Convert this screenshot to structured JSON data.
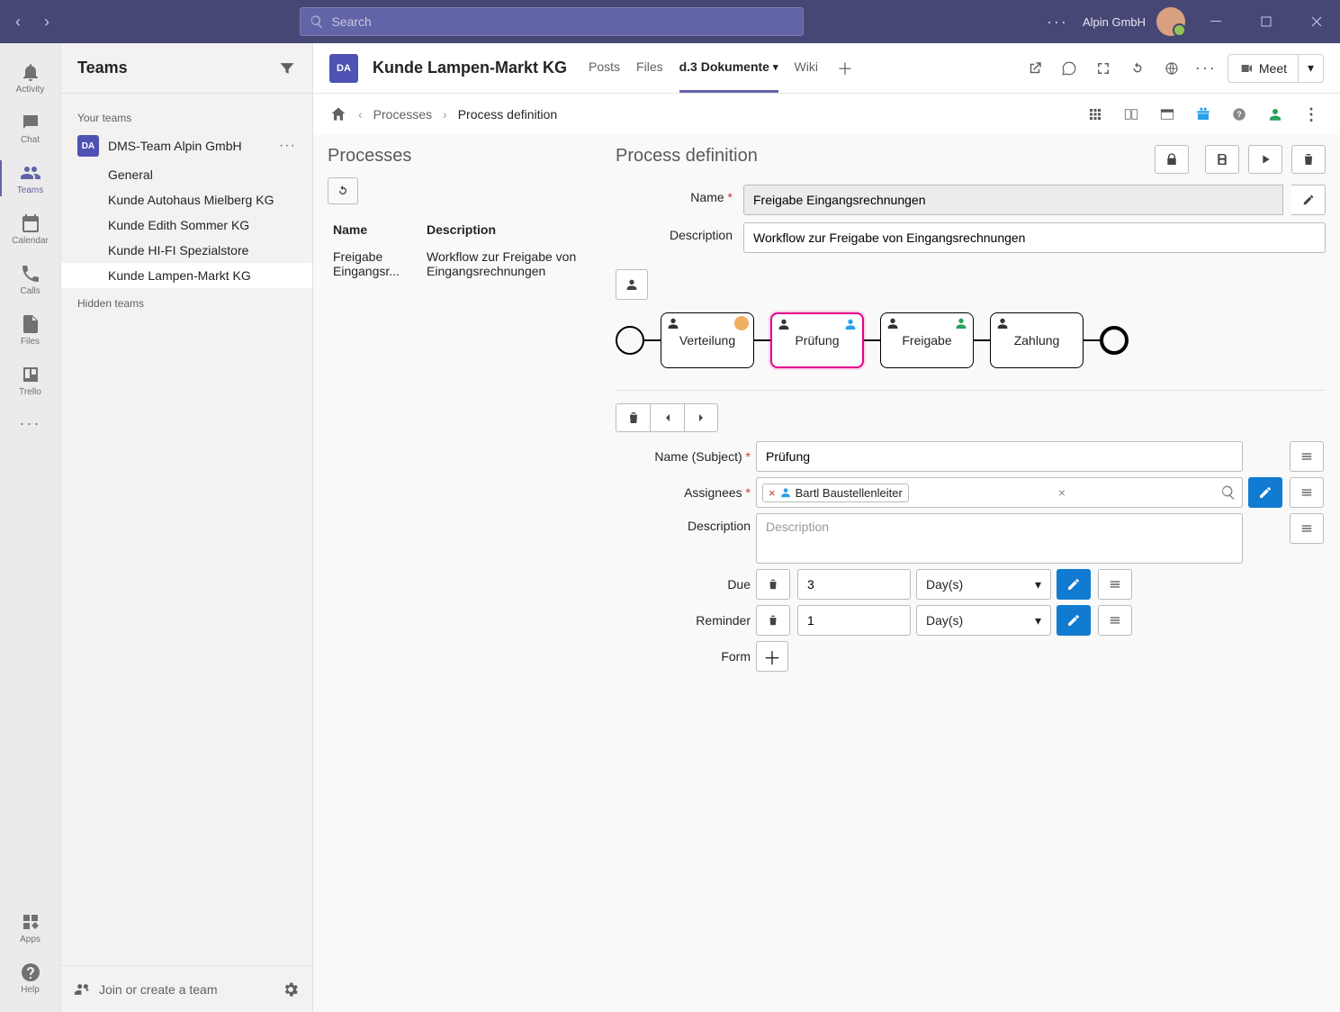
{
  "titlebar": {
    "search_placeholder": "Search",
    "org_name": "Alpin GmbH"
  },
  "rail": {
    "items": [
      {
        "key": "activity",
        "label": "Activity"
      },
      {
        "key": "chat",
        "label": "Chat"
      },
      {
        "key": "teams",
        "label": "Teams"
      },
      {
        "key": "calendar",
        "label": "Calendar"
      },
      {
        "key": "calls",
        "label": "Calls"
      },
      {
        "key": "files",
        "label": "Files"
      },
      {
        "key": "trello",
        "label": "Trello"
      }
    ],
    "apps_label": "Apps",
    "help_label": "Help"
  },
  "teams_panel": {
    "title": "Teams",
    "section_your": "Your teams",
    "team_tile": "DA",
    "team_name": "DMS-Team Alpin GmbH",
    "channels": [
      "General",
      "Kunde Autohaus Mielberg KG",
      "Kunde Edith Sommer KG",
      "Kunde HI-FI Spezialstore",
      "Kunde Lampen-Markt KG"
    ],
    "section_hidden": "Hidden teams",
    "join_label": "Join or create a team"
  },
  "channel_header": {
    "tile": "DA",
    "title": "Kunde Lampen-Markt KG",
    "tabs": [
      "Posts",
      "Files",
      "d.3 Dokumente",
      "Wiki"
    ],
    "meet_label": "Meet"
  },
  "d3": {
    "breadcrumb": {
      "processes": "Processes",
      "definition": "Process definition"
    },
    "processes": {
      "title": "Processes",
      "col_name": "Name",
      "col_desc": "Description",
      "row_name": "Freigabe Eingangsr...",
      "row_desc": "Workflow zur Freigabe von Eingangsrechnungen"
    },
    "definition": {
      "title": "Process definition",
      "label_name": "Name",
      "value_name": "Freigabe Eingangsrechnungen",
      "label_desc": "Description",
      "value_desc": "Workflow zur Freigabe von Eingangsrechnungen",
      "steps": [
        "Verteilung",
        "Prüfung",
        "Freigabe",
        "Zahlung"
      ],
      "step_form": {
        "label_subject": "Name (Subject)",
        "value_subject": "Prüfung",
        "label_assignees": "Assignees",
        "chip_name": "Bartl Baustellenleiter",
        "label_desc": "Description",
        "placeholder_desc": "Description",
        "label_due": "Due",
        "value_due": "3",
        "unit_due": "Day(s)",
        "label_reminder": "Reminder",
        "value_reminder": "1",
        "unit_reminder": "Day(s)",
        "label_form": "Form"
      }
    }
  }
}
